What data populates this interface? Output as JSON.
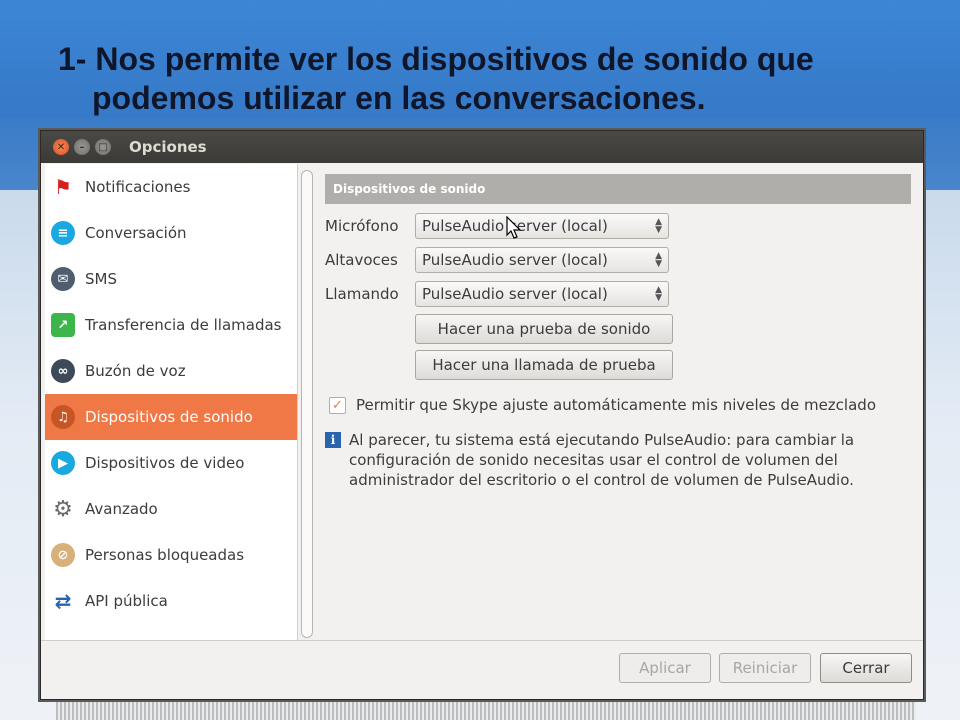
{
  "slide": {
    "title_line1": "1- Nos permite ver los dispositivos de sonido que",
    "title_line2": "podemos utilizar en las conversaciones."
  },
  "window": {
    "title": "Opciones",
    "controls": {
      "close": "close-icon",
      "minimize": "minimize-icon",
      "maximize": "maximize-icon"
    }
  },
  "sidebar": {
    "items": [
      {
        "label": "Notificaciones",
        "icon": "flag-icon"
      },
      {
        "label": "Conversación",
        "icon": "chat-bubble-icon"
      },
      {
        "label": "SMS",
        "icon": "sms-icon"
      },
      {
        "label": "Transferencia de llamadas",
        "icon": "phone-forward-icon"
      },
      {
        "label": "Buzón de voz",
        "icon": "voicemail-icon"
      },
      {
        "label": "Dispositivos de sonido",
        "icon": "headset-icon",
        "selected": true
      },
      {
        "label": "Dispositivos de video",
        "icon": "camera-icon"
      },
      {
        "label": "Avanzado",
        "icon": "gear-icon"
      },
      {
        "label": "Personas bloqueadas",
        "icon": "blocked-user-icon"
      },
      {
        "label": "API pública",
        "icon": "api-arrows-icon"
      }
    ]
  },
  "content": {
    "section_title": "Dispositivos de sonido",
    "microfono": {
      "label": "Micrófono",
      "value": "PulseAudio server (local)"
    },
    "altavoces": {
      "label": "Altavoces",
      "value": "PulseAudio server (local)"
    },
    "llamando": {
      "label": "Llamando",
      "value": "PulseAudio server (local)"
    },
    "test_sound_button": "Hacer una prueba de sonido",
    "test_call_button": "Hacer una llamada de prueba",
    "auto_adjust": {
      "label": "Permitir que Skype ajuste automáticamente mis niveles de mezclado",
      "checked": true
    },
    "info": "Al parecer, tu sistema está ejecutando PulseAudio: para cambiar la configuración de sonido necesitas usar el control de volumen del administrador del escritorio o el control de volumen de PulseAudio."
  },
  "footer": {
    "apply": "Aplicar",
    "reset": "Reiniciar",
    "close": "Cerrar"
  },
  "colors": {
    "accent": "#f07746",
    "slide_blue": "#3b7cc8"
  }
}
